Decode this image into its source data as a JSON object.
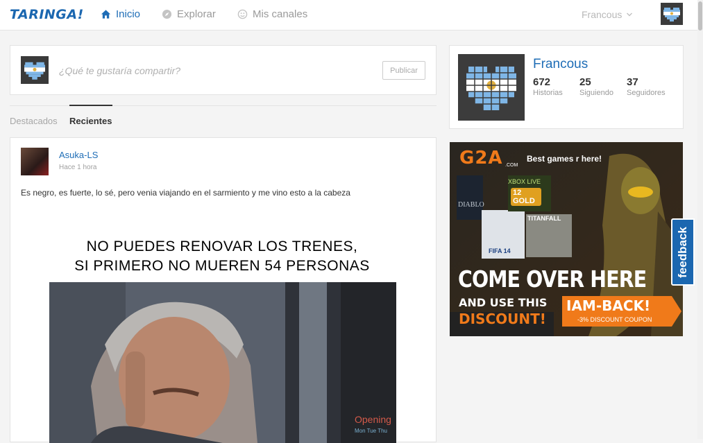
{
  "header": {
    "logo": "TARINGA!",
    "nav": [
      {
        "label": "Inicio",
        "icon": "home-icon",
        "active": true
      },
      {
        "label": "Explorar",
        "icon": "compass-icon",
        "active": false
      },
      {
        "label": "Mis canales",
        "icon": "smiley-icon",
        "active": false
      }
    ],
    "user": "Francous"
  },
  "compose": {
    "placeholder": "¿Qué te gustaría compartir?",
    "publish_label": "Publicar"
  },
  "tabs": [
    {
      "label": "Destacados",
      "active": false
    },
    {
      "label": "Recientes",
      "active": true
    }
  ],
  "post": {
    "author": "Asuka-LS",
    "time": "Hace 1 hora",
    "text": "Es negro, es fuerte, lo sé, pero venia viajando en el sarmiento y me vino esto a la cabeza",
    "meme_line1": "NO PUEDES RENOVAR LOS TRENES,",
    "meme_line2": "SI PRIMERO NO MUEREN 54 PERSONAS",
    "meme_sign": "Opening",
    "meme_sign2": "Mon Tue Thu"
  },
  "profile": {
    "name": "Francous",
    "stats": [
      {
        "value": "672",
        "label": "Historias"
      },
      {
        "value": "25",
        "label": "Siguiendo"
      },
      {
        "value": "37",
        "label": "Seguidores"
      }
    ]
  },
  "ad": {
    "brand": "G2A",
    "brand_sub": ".COM",
    "tagline": "Best games r here!",
    "xbox_line1": "XBOX LIVE",
    "xbox_line2": "GOLD",
    "xbox_months": "12",
    "game1": "DIABLO",
    "game2": "FIFA 14",
    "game3": "TITANFALL",
    "headline": "COME OVER HERE",
    "sub1": "AND USE THIS",
    "sub2": "DISCOUNT!",
    "coupon": "IAM-BACK!",
    "coupon_sub": "-3% DISCOUNT COUPON"
  },
  "feedback_label": "feedback",
  "colors": {
    "brand": "#1b67b0",
    "link": "#1e6db6",
    "ad_orange": "#f07a1a"
  }
}
